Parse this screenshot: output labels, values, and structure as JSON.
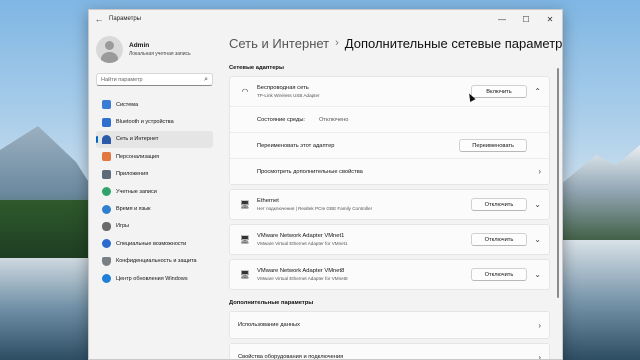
{
  "window": {
    "title": "Параметры",
    "controls": [
      "—",
      "☐",
      "✕"
    ]
  },
  "profile": {
    "name": "Admin",
    "subtitle": "Локальная учетная запись"
  },
  "search": {
    "placeholder": "Найти параметр"
  },
  "sidebar": {
    "items": [
      {
        "label": "Система",
        "icon": "system-icon",
        "color": "#3a7bd5"
      },
      {
        "label": "Bluetooth и устройства",
        "icon": "bluetooth-icon",
        "color": "#2f6fd0"
      },
      {
        "label": "Сеть и Интернет",
        "icon": "network-icon",
        "color": "#2b5aa8",
        "active": true
      },
      {
        "label": "Персонализация",
        "icon": "brush-icon",
        "color": "#e2773f"
      },
      {
        "label": "Приложения",
        "icon": "apps-icon",
        "color": "#5b6b7a"
      },
      {
        "label": "Учетные записи",
        "icon": "accounts-icon",
        "color": "#2fa36b"
      },
      {
        "label": "Время и язык",
        "icon": "clock-globe-icon",
        "color": "#2f7fcf"
      },
      {
        "label": "Игры",
        "icon": "gamepad-icon",
        "color": "#6a6a6a"
      },
      {
        "label": "Специальные возможности",
        "icon": "accessibility-icon",
        "color": "#2b6ad0"
      },
      {
        "label": "Конфиденциальность и защита",
        "icon": "shield-icon",
        "color": "#7a7f86"
      },
      {
        "label": "Центр обновления Windows",
        "icon": "update-icon",
        "color": "#1f7fd6"
      }
    ]
  },
  "breadcrumb": {
    "parent": "Сеть и Интернет",
    "separator": "›",
    "current": "Дополнительные сетевые параметры"
  },
  "adapters": {
    "title": "Сетевые адаптеры",
    "wireless": {
      "name": "Беспроводная сеть",
      "description": "TP-Link Wireless USB Adapter",
      "button": "Включить",
      "status_label": "Состояние среды:",
      "status_value": "Отключено",
      "rename_label": "Переименовать этот адаптер",
      "rename_button": "Переименовать",
      "more_label": "Просмотреть дополнительные свойства"
    },
    "list": [
      {
        "name": "Ethernet",
        "description": "Нет подключения | Realtek PCIe GBE Family Controller",
        "button": "Отключить"
      },
      {
        "name": "VMware Network Adapter VMnet1",
        "description": "VMware Virtual Ethernet Adapter for VMnet1",
        "button": "Отключить"
      },
      {
        "name": "VMware Network Adapter VMnet8",
        "description": "VMware Virtual Ethernet Adapter for VMnet8",
        "button": "Отключить"
      }
    ]
  },
  "more_settings": {
    "title": "Дополнительные параметры",
    "items": [
      "Использование данных",
      "Свойства оборудования и подключения"
    ]
  }
}
